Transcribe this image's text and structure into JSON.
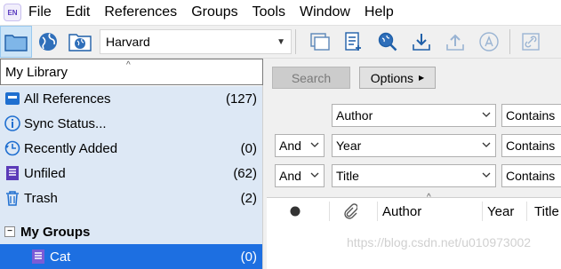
{
  "app": {
    "logo_text": "EN"
  },
  "menu": [
    "File",
    "Edit",
    "References",
    "Groups",
    "Tools",
    "Window",
    "Help"
  ],
  "toolbar": {
    "output_style": "Harvard",
    "left_buttons": [
      "local-library-icon",
      "online-search-icon",
      "integrated-library-icon"
    ],
    "right_buttons": [
      "copy-to-library-icon",
      "new-reference-icon",
      "find-full-text-icon",
      "import-icon",
      "export-icon",
      "open-pdf-icon",
      "link-icon"
    ]
  },
  "left": {
    "library_header": "My Library",
    "items": [
      {
        "label": "All References",
        "count": "(127)",
        "icon": "all-references-icon"
      },
      {
        "label": "Sync Status...",
        "count": "",
        "icon": "sync-status-icon"
      },
      {
        "label": "Recently Added",
        "count": "(0)",
        "icon": "recently-added-icon"
      },
      {
        "label": "Unfiled",
        "count": "(62)",
        "icon": "unfiled-icon"
      },
      {
        "label": "Trash",
        "count": "(2)",
        "icon": "trash-icon"
      }
    ],
    "my_groups": {
      "label": "My Groups",
      "expander": "−"
    },
    "groups": [
      {
        "label": "Cat",
        "count": "(0)",
        "icon": "group-icon"
      }
    ]
  },
  "search": {
    "search_label": "Search",
    "options_label": "Options",
    "rows": [
      {
        "bool": "",
        "field": "Author",
        "op": "Contains"
      },
      {
        "bool": "And",
        "field": "Year",
        "op": "Contains"
      },
      {
        "bool": "And",
        "field": "Title",
        "op": "Contains"
      }
    ]
  },
  "results": {
    "columns": [
      "Author",
      "Year",
      "Title"
    ],
    "watermark": "https://blog.csdn.net/u010973002"
  },
  "colors": {
    "selected": "#1d6fe1",
    "panel": "#dde8f5",
    "toolbar": "#f0f0f0"
  }
}
